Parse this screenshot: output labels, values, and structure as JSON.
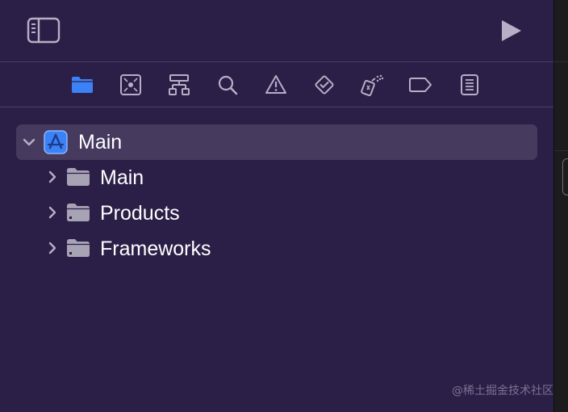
{
  "toolbar": {
    "sidebar_toggle_icon": "sidebar-left-icon",
    "run_icon": "play-icon"
  },
  "navigator": {
    "icons": [
      {
        "name": "project-navigator-icon",
        "active": true
      },
      {
        "name": "source-control-navigator-icon",
        "active": false
      },
      {
        "name": "symbol-navigator-icon",
        "active": false
      },
      {
        "name": "find-navigator-icon",
        "active": false
      },
      {
        "name": "issue-navigator-icon",
        "active": false
      },
      {
        "name": "test-navigator-icon",
        "active": false
      },
      {
        "name": "debug-navigator-icon",
        "active": false
      },
      {
        "name": "breakpoint-navigator-icon",
        "active": false
      },
      {
        "name": "report-navigator-icon",
        "active": false
      }
    ]
  },
  "tree": {
    "project": {
      "label": "Main",
      "expanded": true,
      "icon": "xcode-project-icon"
    },
    "groups": [
      {
        "label": "Main",
        "expanded": false,
        "icon": "folder-icon"
      },
      {
        "label": "Products",
        "expanded": false,
        "icon": "folder-icon"
      },
      {
        "label": "Frameworks",
        "expanded": false,
        "icon": "folder-icon"
      }
    ]
  },
  "watermark": "@稀土掘金技术社区",
  "colors": {
    "background": "#2c1f47",
    "selection": "#463a5f",
    "accent": "#3b82f6",
    "icon_gray": "#b6afc6",
    "folder_gray": "#a8a2b5"
  }
}
